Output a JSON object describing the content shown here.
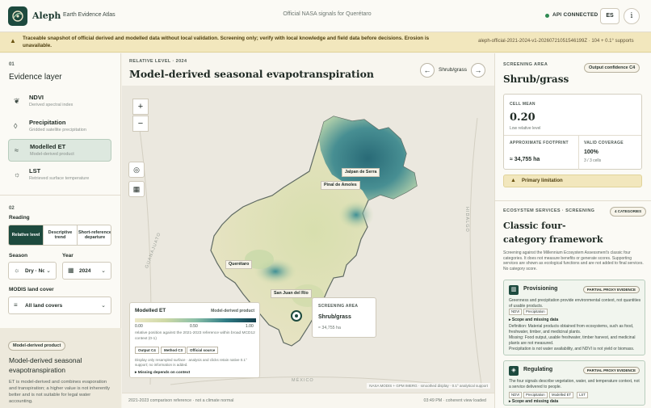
{
  "header": {
    "brand": "Aleph",
    "subtitle": "Earth Evidence Atlas",
    "center_title": "Official NASA signals for Querétaro",
    "api_status": "API CONNECTED",
    "lang": "ES",
    "info_glyph": "i"
  },
  "banner": {
    "text": "Traceable snapshot of official derived and modelled data without local validation. Screening only; verify with local knowledge and field data before decisions. Erosion is unavailable.",
    "snapshot_id": "aleph-official-2021-2024-v1-20260721051546199Z · 104 + 0.1° supports"
  },
  "sidebar": {
    "section1_num": "01",
    "section1_title": "Evidence layer",
    "layers": [
      {
        "name": "NDVI",
        "desc": "Derived spectral index",
        "icon": "leaf-icon"
      },
      {
        "name": "Precipitation",
        "desc": "Gridded satellite precipitation",
        "icon": "drop-icon"
      },
      {
        "name": "Modelled ET",
        "desc": "Model-derived product",
        "icon": "waves-icon"
      },
      {
        "name": "LST",
        "desc": "Retrieved surface temperature",
        "icon": "sun-icon"
      }
    ],
    "section2_num": "02",
    "reading_label": "Reading",
    "reading_options": [
      "Relative level",
      "Descriptive trend",
      "Short-reference departure"
    ],
    "season_label": "Season",
    "season_value": "Dry · Nov",
    "year_label": "Year",
    "year_value": "2024",
    "landcover_label": "MODIS land cover",
    "landcover_value": "All land covers",
    "product_tag": "Model-derived product",
    "product_title": "Model-derived seasonal evapotranspiration",
    "product_text": "ET is model-derived and combines evaporation and transpiration; a higher value is not inherently better and is not suitable for legal water accounting."
  },
  "main": {
    "kicker": "RELATIVE LEVEL · 2024",
    "title": "Model-derived seasonal evapotranspiration",
    "nav_label": "Shrub/grass",
    "zoom_in": "+",
    "zoom_out": "−",
    "places": [
      "Jalpan de Serra",
      "Pinal de Amoles",
      "Querétaro",
      "San Juan del Río"
    ],
    "neighbors": [
      "GUANAJUATO",
      "HIDALGO",
      "MÉXICO"
    ],
    "legend": {
      "title": "Modelled ET",
      "subtitle": "Model-derived product",
      "ticks": [
        "0.00",
        "0.50",
        "1.00"
      ],
      "desc": "relative position against the 2021-2023 reference within broad MCD12 context (0-1)",
      "chips": [
        "Output C4",
        "Method C3",
        "Official source"
      ],
      "note": "Display only resampled surface · analysis and clicks retain native 0.1° support; no information is added.",
      "more": "▸ Missing depends on context"
    },
    "popup": {
      "kicker": "SCREENING AREA",
      "name": "Shrub/grass",
      "value": "≈ 34,755 ha"
    },
    "attribution": "NASA MODIS + GPM IMERG · smoothed display · 0.1° analytical support",
    "footer_left": "2021-2023 comparison reference · not a climate normal",
    "footer_right": "03:49 PM · coherent view loaded"
  },
  "right": {
    "kicker": "SCREENING AREA",
    "title": "Shrub/grass",
    "confidence": "Output confidence C4",
    "cell_mean_label": "CELL MEAN",
    "cell_mean_value": "0.20",
    "cell_mean_sub": "Low relative level",
    "footprint_label": "APPROXIMATE FOOTPRINT",
    "footprint_value": "≈ 34,755 ha",
    "coverage_label": "VALID COVERAGE",
    "coverage_value": "100%",
    "coverage_sub": "3 / 3 cells",
    "limitation": "Primary limitation",
    "eco_kicker": "ECOSYSTEM SERVICES · SCREENING",
    "eco_badge": "4 CATEGORIES",
    "eco_title": "Classic four-category framework",
    "eco_text": "Screening against the Millennium Ecosystem Assessment's classic four categories. It does not measure benefits or generate scores. Supporting services are shown as ecological functions and are not added to final services. No category score.",
    "services": [
      {
        "name": "Provisioning",
        "badge": "PARTIAL PROXY EVIDENCE",
        "text": "Greenness and precipitation provide environmental context, not quantities of usable products.",
        "chips": [
          "NDVI",
          "Precipitation"
        ],
        "scope": "▸ Scope and missing data",
        "definition": "Definition: Material products obtained from ecosystems, such as food, freshwater, timber, and medicinal plants.",
        "missing": "Missing: Food output, usable freshwater, timber harvest, and medicinal plants are not measured.",
        "note": "Precipitation is not water availability, and NDVI is not yield or biomass."
      },
      {
        "name": "Regulating",
        "badge": "PARTIAL PROXY EVIDENCE",
        "text": "The four signals describe vegetation, water, and temperature context, not a service delivered to people.",
        "chips": [
          "NDVI",
          "Precipitation",
          "Modelled ET",
          "LST"
        ],
        "scope": "▸ Scope and missing data"
      }
    ]
  }
}
